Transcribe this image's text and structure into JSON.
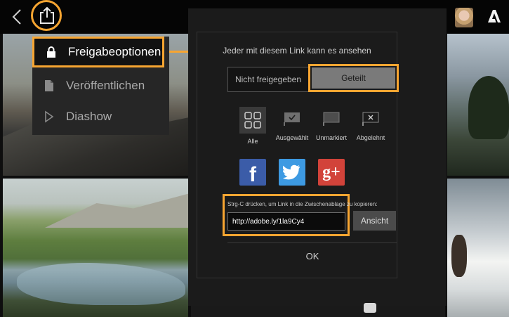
{
  "topbar": {
    "back_icon": "chevron-left-icon",
    "share_icon": "share-upload-icon",
    "avatar_icon": "user-avatar",
    "brand_icon": "adobe-logo-icon"
  },
  "menu": {
    "items": [
      {
        "label": "Freigabeoptionen",
        "icon": "lock-icon"
      },
      {
        "label": "Veröffentlichen",
        "icon": "document-icon"
      },
      {
        "label": "Diashow",
        "icon": "play-icon"
      }
    ]
  },
  "dialog": {
    "title": "Jeder mit diesem Link kann es ansehen",
    "segment": {
      "off_label": "Nicht freigegeben",
      "on_label": "Geteilt",
      "selected": "Geteilt"
    },
    "filters": [
      {
        "label": "Alle",
        "icon": "grid-icon"
      },
      {
        "label": "Ausgewählt",
        "icon": "flag-check-icon"
      },
      {
        "label": "Unmarkiert",
        "icon": "flag-empty-icon"
      },
      {
        "label": "Abgelehnt",
        "icon": "flag-x-icon"
      }
    ],
    "social": {
      "facebook": "f",
      "twitter": "twitter-bird-icon",
      "google_plus": "g+"
    },
    "copy_hint": "Strg-C drücken, um Link in die Zwischenablage zu kopieren:",
    "link_value": "http://adobe.ly/1la9Cy4",
    "view_label": "Ansicht",
    "ok_label": "OK"
  },
  "colors": {
    "highlight": "#f7a531",
    "facebook": "#3b5ca8",
    "twitter": "#3d9ae2",
    "google_plus": "#d2433a"
  }
}
